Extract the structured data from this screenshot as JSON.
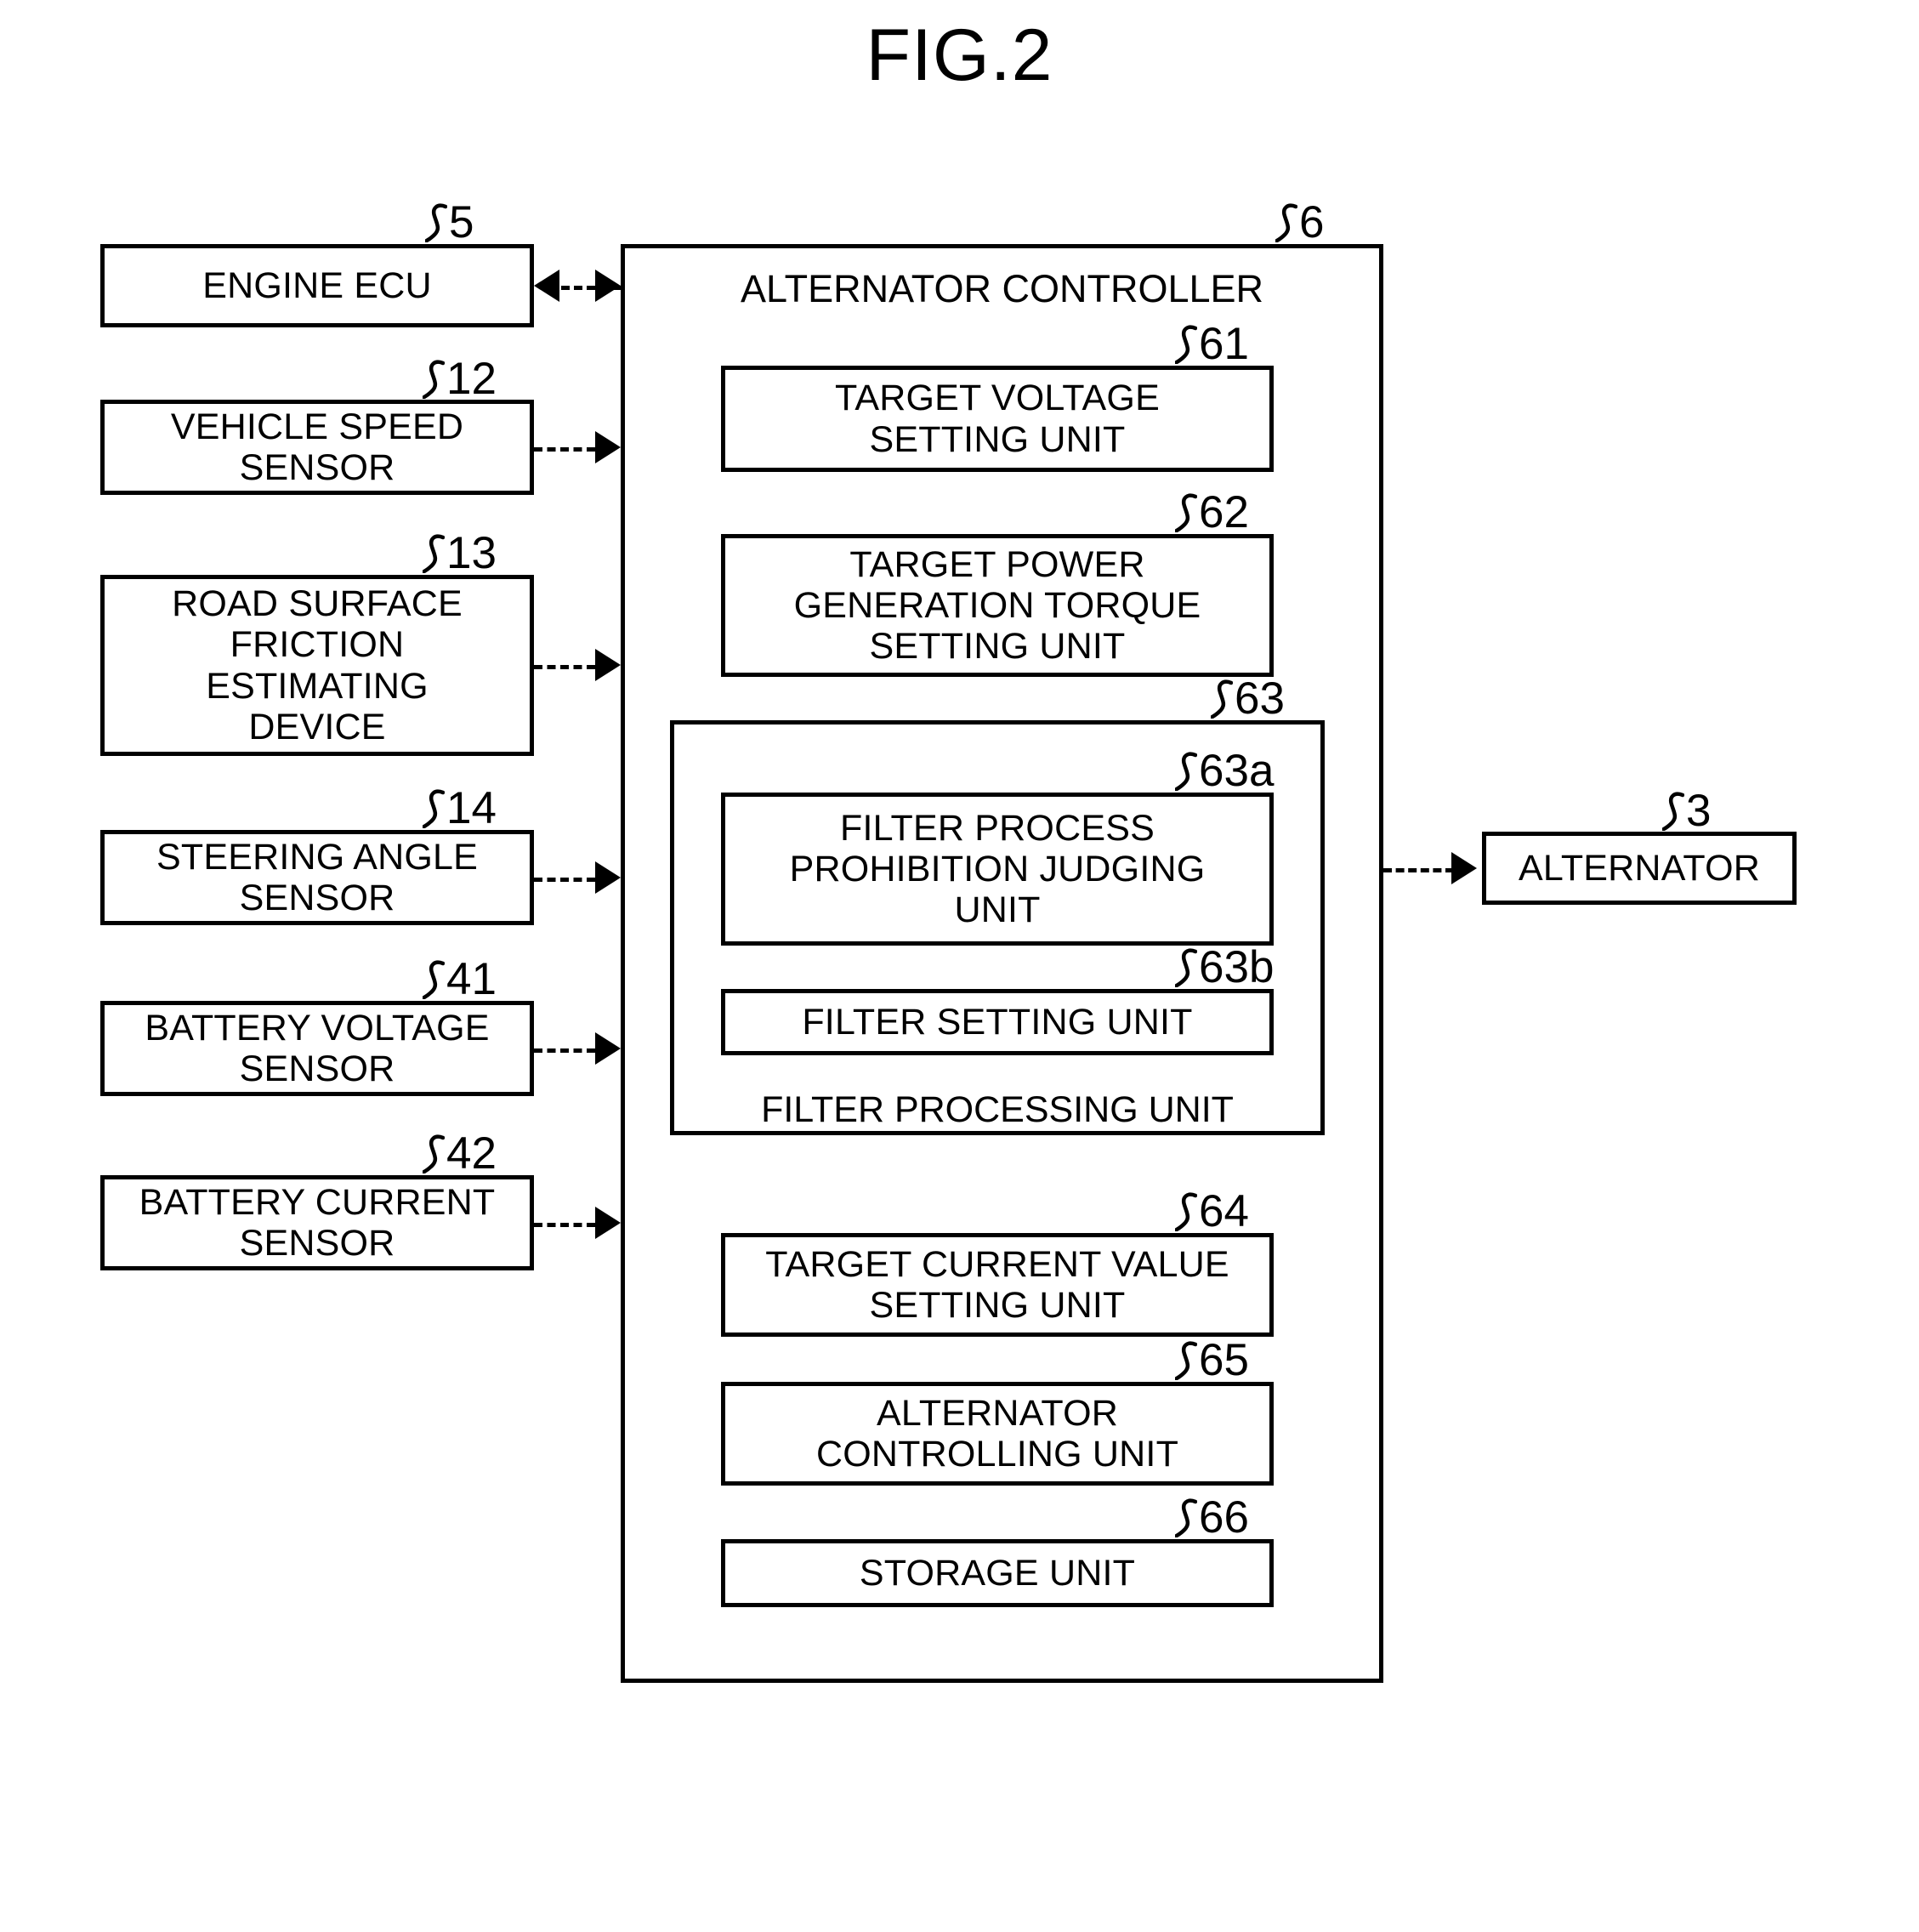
{
  "figure": {
    "title": "FIG.2"
  },
  "inputs": [
    {
      "id": "engine-ecu",
      "label": "ENGINE ECU",
      "ref": "5",
      "connector": "bidirectional"
    },
    {
      "id": "vehicle-speed",
      "label": "VEHICLE SPEED\nSENSOR",
      "ref": "12",
      "connector": "to-controller"
    },
    {
      "id": "road-friction",
      "label": "ROAD SURFACE\nFRICTION\nESTIMATING\nDEVICE",
      "ref": "13",
      "connector": "to-controller"
    },
    {
      "id": "steering-angle",
      "label": "STEERING ANGLE\nSENSOR",
      "ref": "14",
      "connector": "to-controller"
    },
    {
      "id": "battery-voltage",
      "label": "BATTERY VOLTAGE\nSENSOR",
      "ref": "41",
      "connector": "to-controller"
    },
    {
      "id": "battery-current",
      "label": "BATTERY CURRENT\nSENSOR",
      "ref": "42",
      "connector": "to-controller"
    }
  ],
  "controller": {
    "title": "ALTERNATOR CONTROLLER",
    "ref": "6",
    "units": [
      {
        "id": "target-voltage",
        "label": "TARGET VOLTAGE\nSETTING UNIT",
        "ref": "61"
      },
      {
        "id": "target-power-torque",
        "label": "TARGET POWER\nGENERATION TORQUE\nSETTING UNIT",
        "ref": "62"
      },
      {
        "id": "target-current-value",
        "label": "TARGET CURRENT VALUE\nSETTING UNIT",
        "ref": "64"
      },
      {
        "id": "alternator-controlling",
        "label": "ALTERNATOR\nCONTROLLING UNIT",
        "ref": "65"
      },
      {
        "id": "storage",
        "label": "STORAGE UNIT",
        "ref": "66"
      }
    ],
    "filter_processing_unit": {
      "caption": "FILTER PROCESSING UNIT",
      "ref": "63",
      "subunits": [
        {
          "id": "filter-prohibition-judging",
          "label": "FILTER PROCESS\nPROHIBITION JUDGING\nUNIT",
          "ref": "63a"
        },
        {
          "id": "filter-setting",
          "label": "FILTER SETTING UNIT",
          "ref": "63b"
        }
      ]
    }
  },
  "output": {
    "id": "alternator",
    "label": "ALTERNATOR",
    "ref": "3"
  },
  "colors": {
    "ink": "#000000",
    "paper": "#ffffff"
  }
}
